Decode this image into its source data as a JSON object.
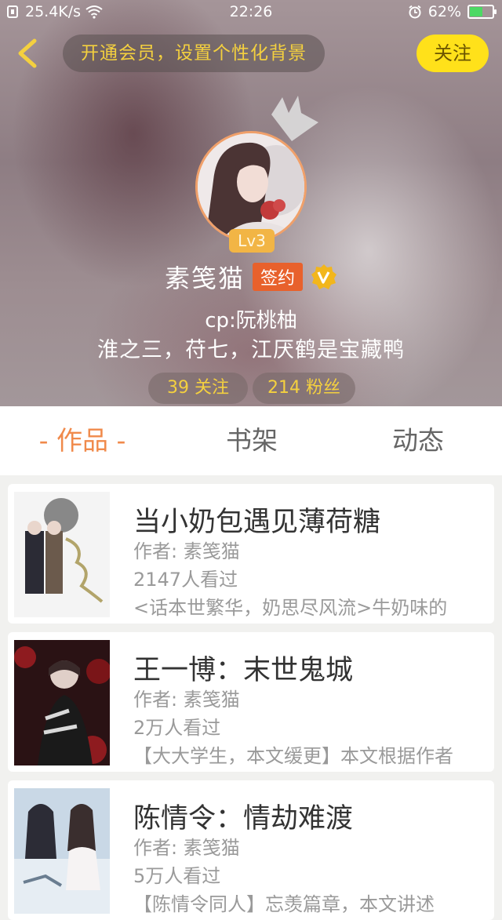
{
  "status_bar": {
    "speed": "25.4K/s",
    "time": "22:26",
    "battery": "62%",
    "battery_level": 0.62
  },
  "header": {
    "vip_promo": "开通会员，设置个性化背景",
    "follow_label": "关注"
  },
  "profile": {
    "level": "Lv3",
    "username": "素笺猫",
    "signed_badge": "签约",
    "cp_line": "cp:阮桃柚",
    "bio": "淮之三，苻七，江厌鹤是宝藏鸭",
    "following": "39 关注",
    "fans": "214 粉丝"
  },
  "tabs": [
    {
      "label": "- 作品 -",
      "active": true
    },
    {
      "label": "书架",
      "active": false
    },
    {
      "label": "动态",
      "active": false
    }
  ],
  "books": [
    {
      "title": "当小奶包遇见薄荷糖",
      "author": "作者: 素笺猫",
      "views": "2147人看过",
      "desc": "<话本世繁华，奶思尽风流>牛奶味的"
    },
    {
      "title": "王一博：末世鬼城",
      "author": "作者: 素笺猫",
      "views": "2万人看过",
      "desc": "【大大学生，本文缓更】本文根据作者"
    },
    {
      "title": "陈情令：情劫难渡",
      "author": "作者: 素笺猫",
      "views": "5万人看过",
      "desc": "【陈情令同人】忘羡篇章，本文讲述"
    }
  ],
  "colors": {
    "accent_orange": "#f08a4b",
    "follow_yellow": "#ffe11a",
    "promo_text": "#f4d03f",
    "signed_badge": "#e8612c"
  },
  "icons": {
    "back": "chevron-left-icon",
    "crown": "crown-icon",
    "verified": "v-badge-icon",
    "wifi": "wifi-icon",
    "alarm": "alarm-icon",
    "battery": "battery-icon"
  }
}
